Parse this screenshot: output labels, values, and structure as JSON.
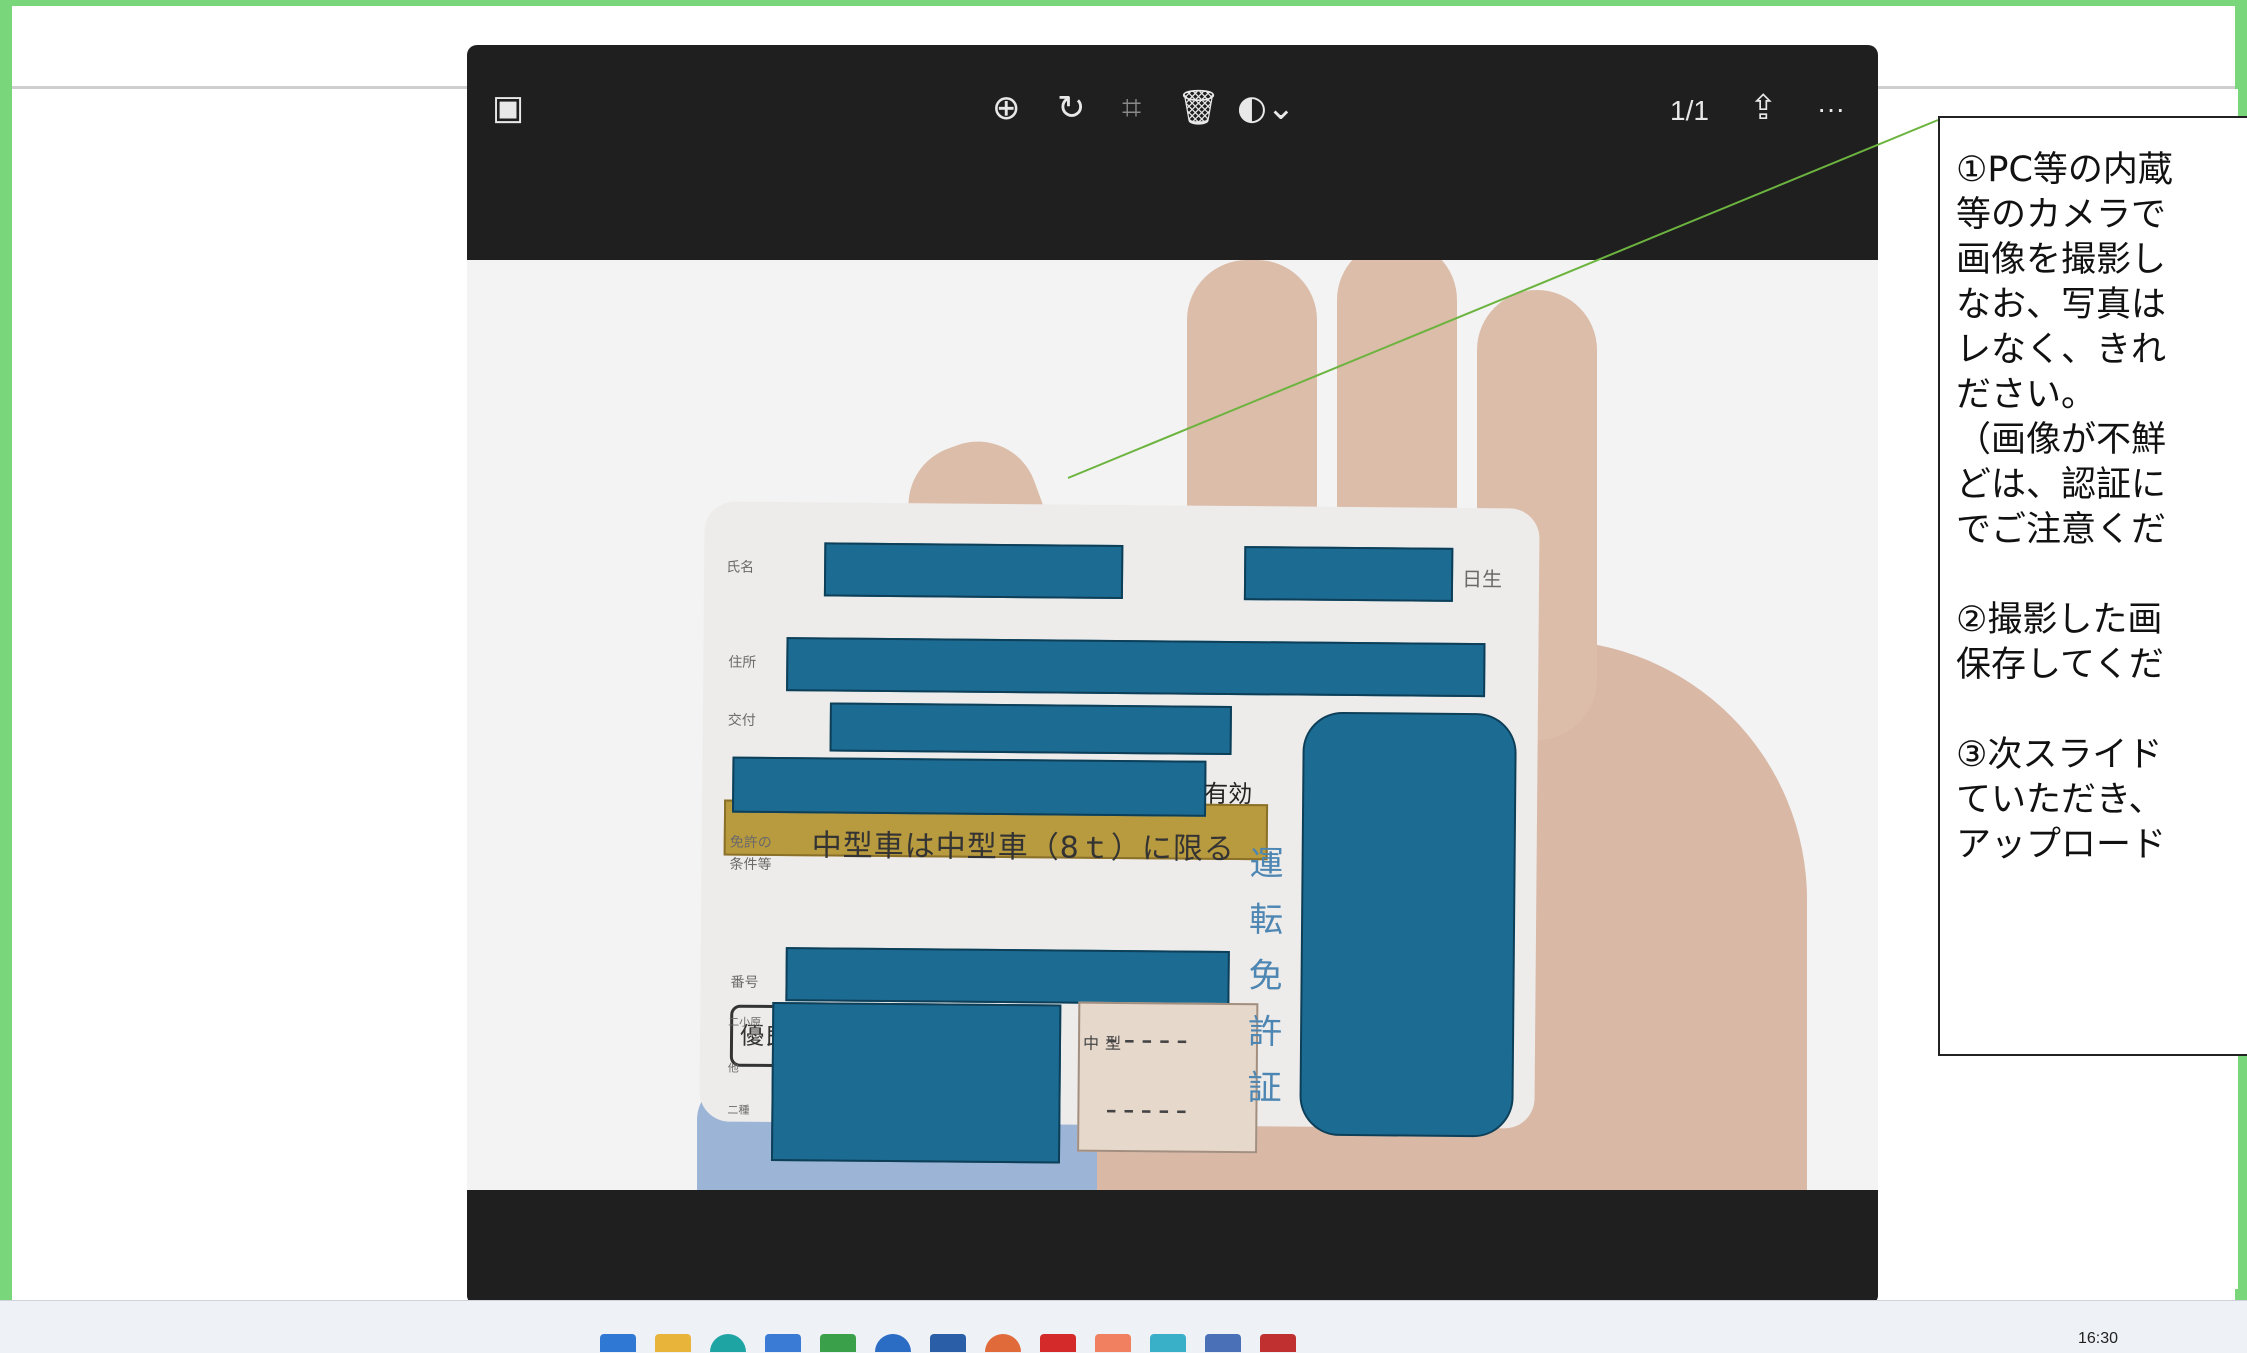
{
  "viewer": {
    "page_counter": "1/1",
    "more_label": "···",
    "icons": [
      "image-icon",
      "zoom-in-icon",
      "rotate-icon",
      "crop-icon",
      "delete-icon",
      "edit-filter-icon",
      "share-icon",
      "more-icon"
    ]
  },
  "license_card": {
    "name_label": "氏名",
    "birth_suffix": "日生",
    "address_label": "住所",
    "issue_label": "交付",
    "expiry_suffix": "有効",
    "conditions_label_1": "免許の",
    "conditions_label_2": "条件等",
    "condition_text": "中型車は中型車（8ｔ）に限る",
    "badge_text": "優良",
    "number_label": "番号",
    "vertical_title": [
      "運",
      "転",
      "免",
      "許",
      "証"
    ],
    "class_labels": [
      "二小原",
      "他",
      "二種"
    ],
    "grid_label": "中型",
    "grid_rows": [
      "-----",
      "-----"
    ]
  },
  "callout": {
    "lines": [
      "①PC等の内蔵",
      "等のカメラで",
      "画像を撮影し",
      "なお、写真は",
      "レなく、きれ",
      "ださい。",
      "（画像が不鮮",
      "どは、認証に",
      "でご注意くだ",
      "",
      "②撮影した画",
      "保存してくだ",
      "",
      "③次スライド",
      "ていただき、",
      "アップロード"
    ]
  },
  "taskbar": {
    "clock": "16:30"
  },
  "colors": {
    "accent_green": "#7ad67a",
    "redaction_blue": "#1c6b93",
    "viewer_dark": "#1f1f1f",
    "callout_line": "#6cb43f"
  }
}
